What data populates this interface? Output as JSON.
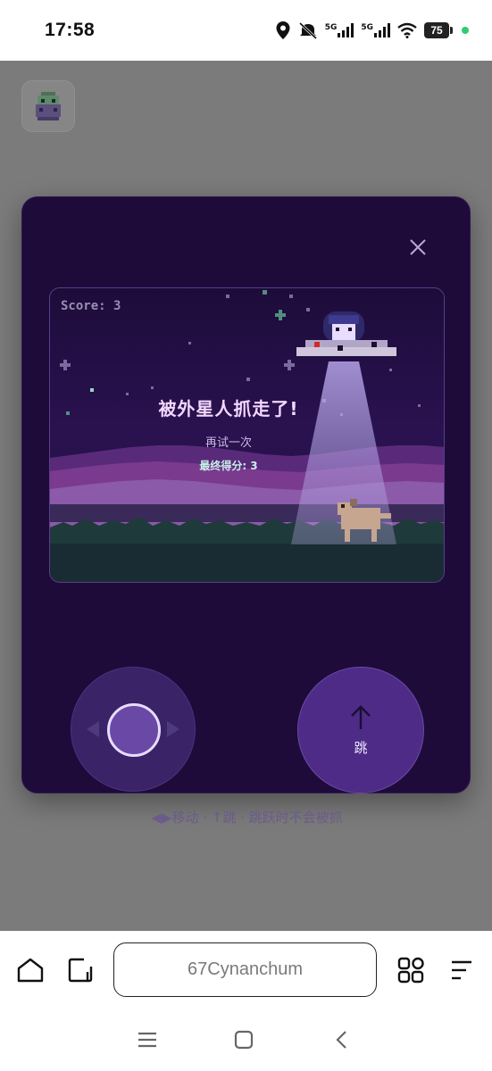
{
  "status_bar": {
    "time": "17:58",
    "signal_1_label": "5G",
    "signal_2_label": "5G",
    "battery": "75"
  },
  "game": {
    "score_label": "Score: 3",
    "result_title": "被外星人抓走了!",
    "retry_label": "再试一次",
    "final_score_label": "最终得分: 3",
    "jump_label": "跳",
    "hint": "◀▶移动 · ↑跳 · 跳跃时不会被抓"
  },
  "browser": {
    "address": "67Cynanchum"
  },
  "icons": {
    "close": "close-icon",
    "jump": "arrow-up-icon",
    "home": "home-icon",
    "tabs": "tabs-icon",
    "apps": "grid-icon",
    "menu": "menu-icon"
  },
  "colors": {
    "modal_bg": "#1e0b3a",
    "accent": "#4d2b86",
    "title": "#f2d7ff"
  }
}
